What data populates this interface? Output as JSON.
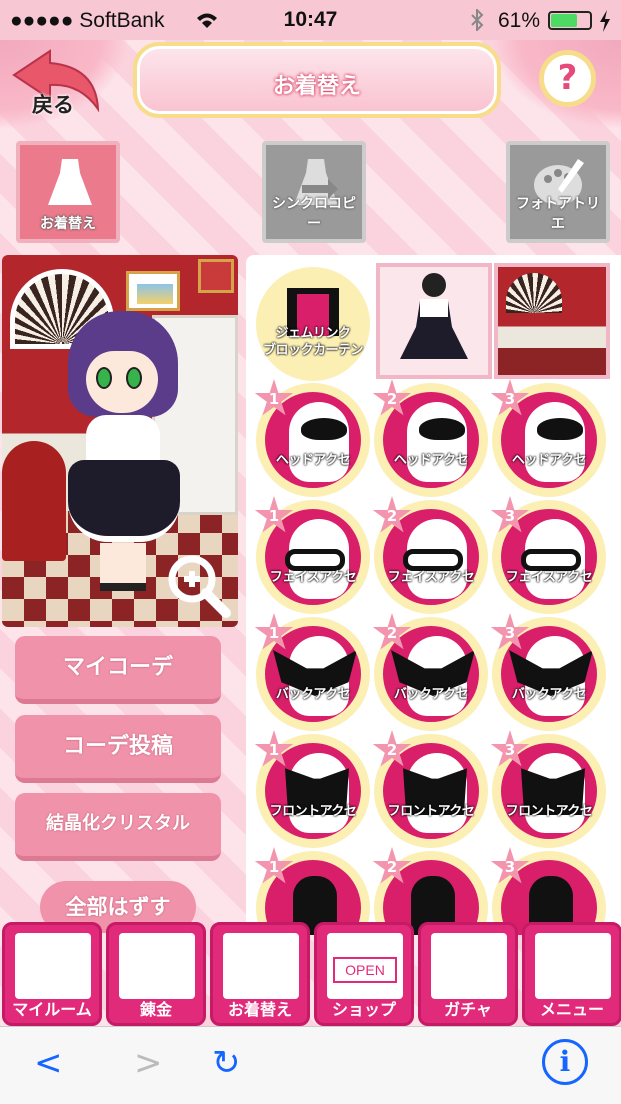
{
  "status_bar": {
    "carrier": "●●●●● SoftBank",
    "time": "10:47",
    "battery_percent": "61%",
    "battery_level": 0.61,
    "icons": [
      "wifi-icon",
      "bluetooth-icon",
      "battery-icon",
      "charging-icon"
    ]
  },
  "header": {
    "title": "お着替え",
    "back_label": "戻る",
    "help_label": "?"
  },
  "mode_tabs": [
    {
      "label": "お着替え",
      "active": true,
      "icon": "dress-icon"
    },
    {
      "label": "シンクロコピー",
      "active": false,
      "icon": "sync-copy-icon"
    },
    {
      "label": "フォトアトリエ",
      "active": false,
      "icon": "palette-icon"
    }
  ],
  "left_buttons": {
    "my_code": "マイコーデ",
    "post_code": "コーデ投稿",
    "crystal": "結晶化クリスタル",
    "remove_all": "全部はずす"
  },
  "grid": {
    "top_row": {
      "curtain_label": "ジェムリンク\nブロックカーテン"
    },
    "rows": [
      {
        "label": "ヘッドアクセ",
        "slots": [
          "1",
          "2",
          "3"
        ],
        "shape": "ribbon"
      },
      {
        "label": "フェイスアクセ",
        "slots": [
          "1",
          "2",
          "3"
        ],
        "shape": "glasses"
      },
      {
        "label": "バックアクセ",
        "slots": [
          "1",
          "2",
          "3"
        ],
        "shape": "wings"
      },
      {
        "label": "フロントアクセ",
        "slots": [
          "1",
          "2",
          "3"
        ],
        "shape": "front"
      },
      {
        "label": "",
        "slots": [
          "1",
          "2",
          "3"
        ],
        "shape": "chair"
      }
    ]
  },
  "bottom_nav": [
    {
      "label": "マイルーム",
      "icon": "room-icon"
    },
    {
      "label": "錬金",
      "icon": "ring-icon"
    },
    {
      "label": "お着替え",
      "icon": "dress-icon"
    },
    {
      "label": "ショップ",
      "icon": "shop-icon",
      "sign": "OPEN"
    },
    {
      "label": "ガチャ",
      "icon": "gacha-icon"
    },
    {
      "label": "メニュー",
      "icon": "menu-icon"
    }
  ],
  "browser_toolbar": {
    "back": "<",
    "forward": ">",
    "reload": "↻",
    "info": "i"
  },
  "colors": {
    "accent_pink": "#e12b7a",
    "button_pink": "#f093aa",
    "gold": "#f7dc8a"
  }
}
